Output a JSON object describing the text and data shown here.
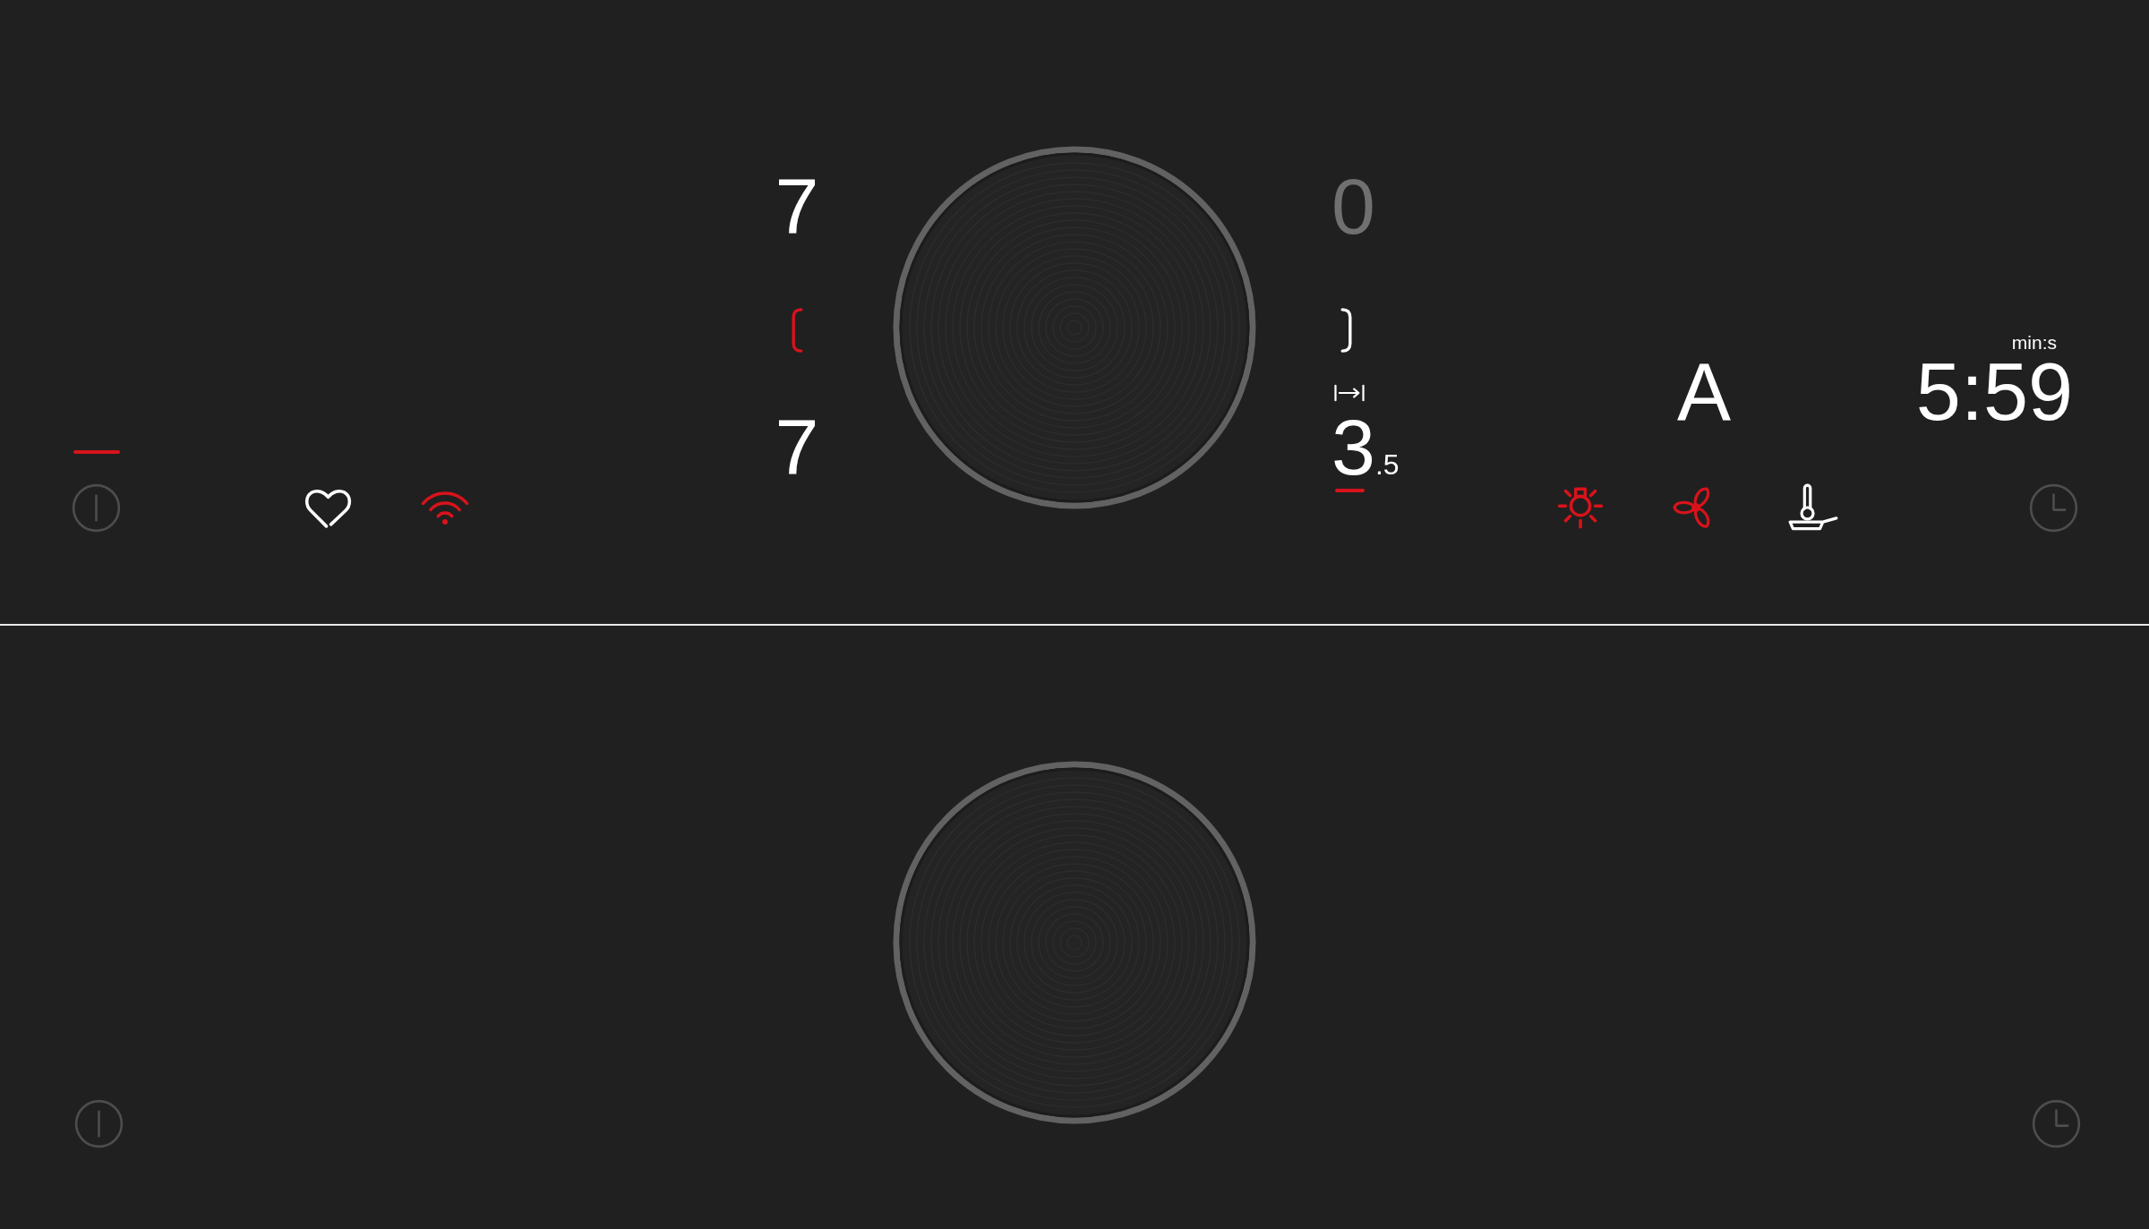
{
  "top_zone": {
    "power_button": {
      "marked": true
    },
    "shortcuts": [
      {
        "kind": "heart",
        "active": false
      },
      {
        "kind": "wifi",
        "active": true
      }
    ],
    "left_display": {
      "upper": {
        "text": "7",
        "lit": true
      },
      "bracket": {
        "active": true
      },
      "lower": {
        "text": "7",
        "lit": true
      }
    },
    "right_display": {
      "upper": {
        "text": "0",
        "lit": false
      },
      "bracket": {
        "active": false
      },
      "level": {
        "text": "3",
        "fraction": ".5",
        "underlined": true
      }
    },
    "right_panel": {
      "mode": "A",
      "timer_unit": "min:s",
      "timer": "5:59",
      "functions": [
        {
          "kind": "light",
          "active": true
        },
        {
          "kind": "fan",
          "active": true
        },
        {
          "kind": "frying",
          "active": false
        }
      ]
    }
  },
  "bottom_zone": {
    "power_button": {
      "marked": false
    }
  }
}
